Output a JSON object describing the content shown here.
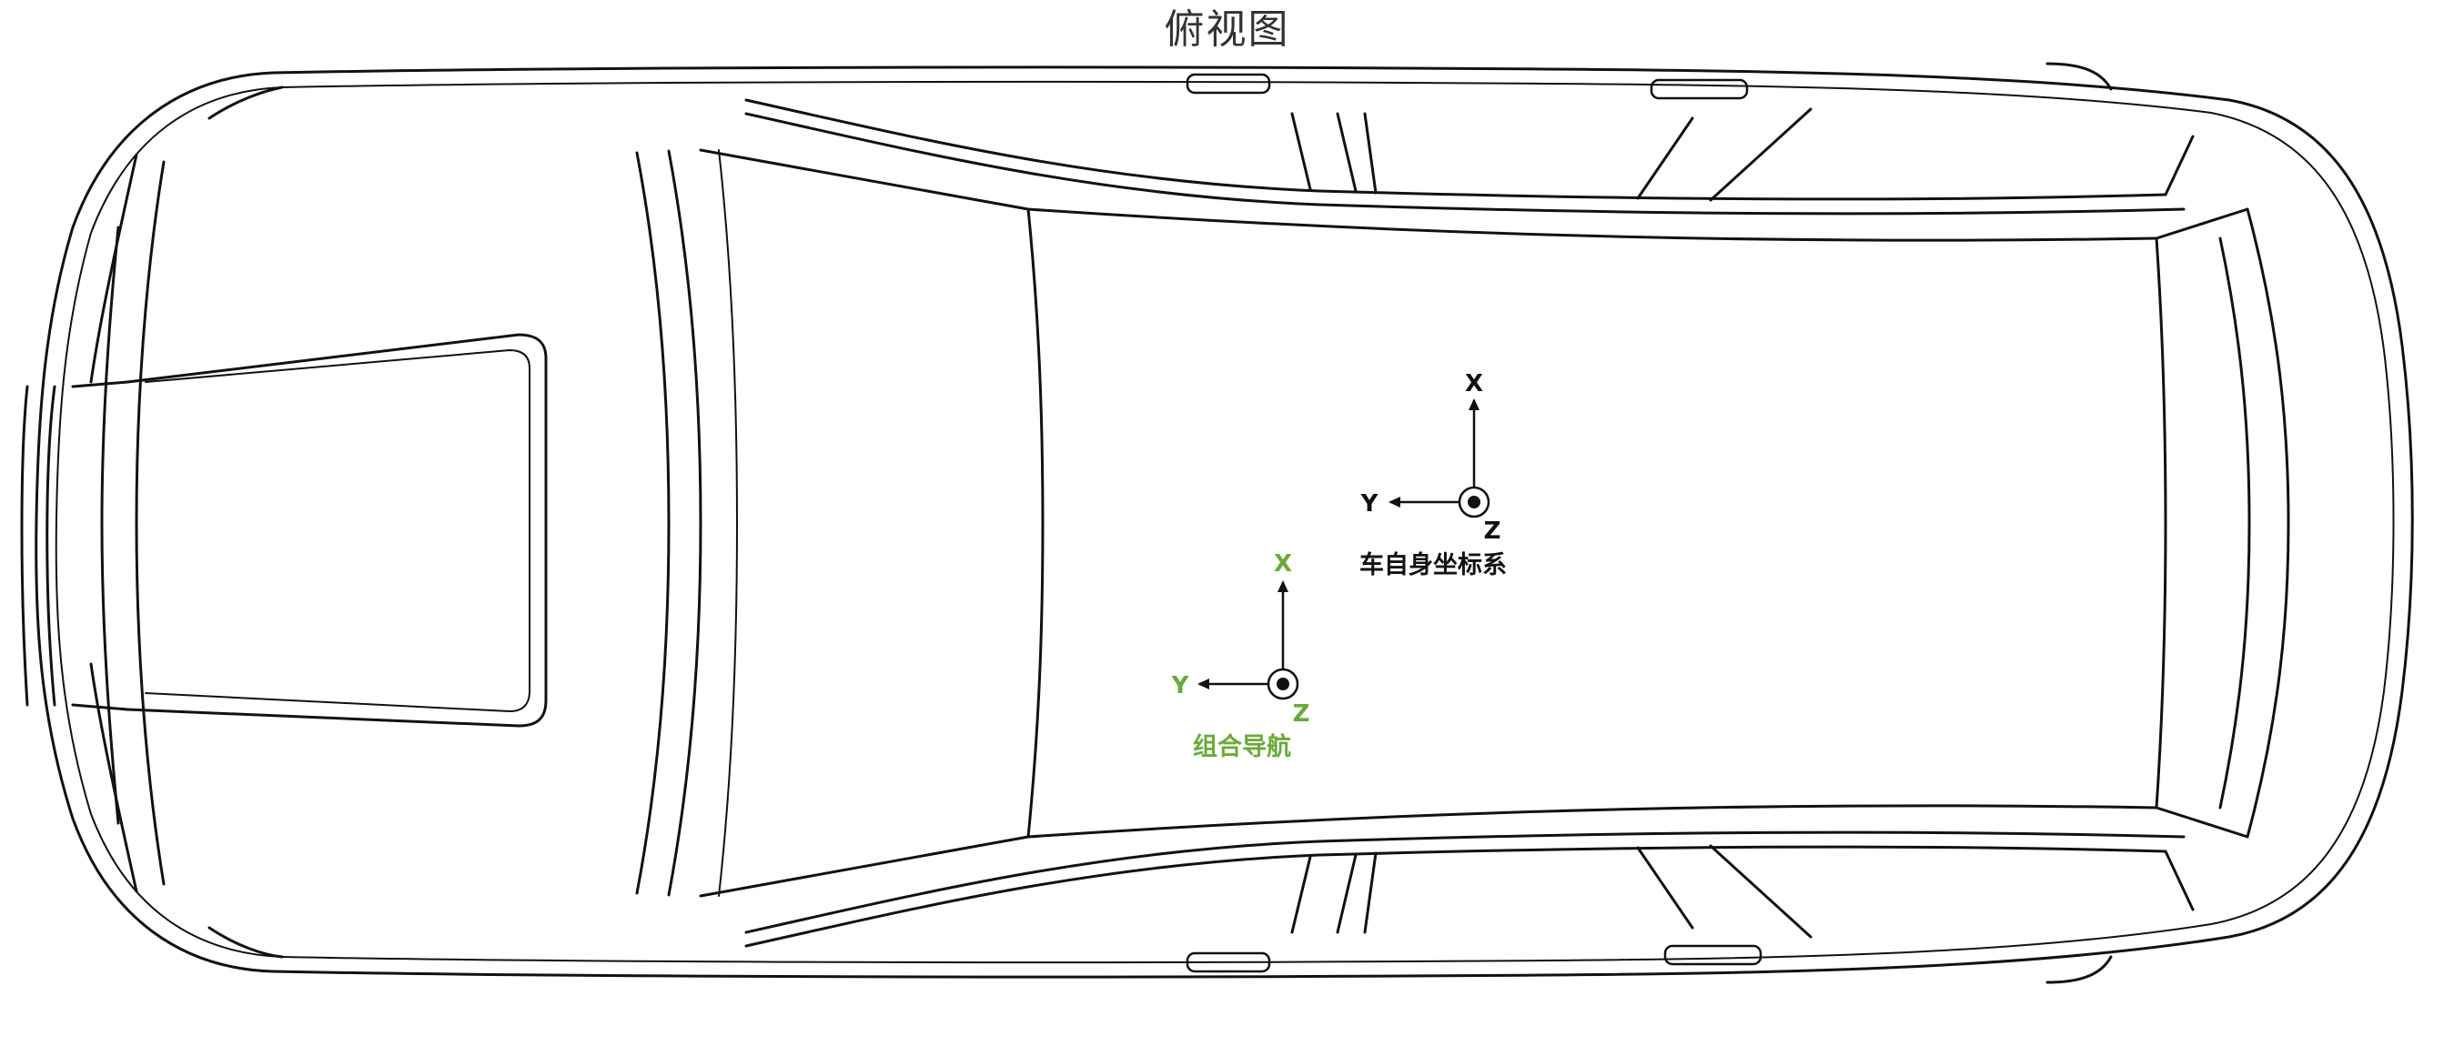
{
  "title": "俯视图",
  "frames": {
    "body": {
      "label": "车自身坐标系",
      "x_axis": "X",
      "y_axis": "Y",
      "z_axis": "Z",
      "color": "#111111"
    },
    "ins": {
      "label": "组合导航",
      "x_axis": "X",
      "y_axis": "Y",
      "z_axis": "Z",
      "color": "#6aaa3a"
    }
  }
}
